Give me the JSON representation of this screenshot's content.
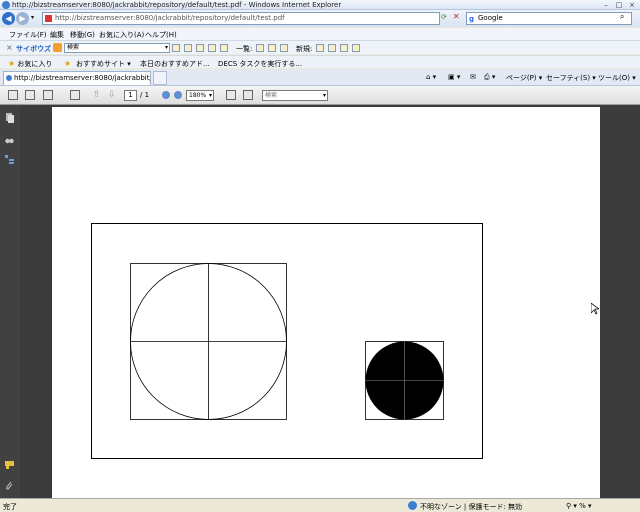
{
  "window": {
    "title": "http://bizstreamserver:8080/jackrabbit/repository/default/test.pdf - Windows Internet Explorer"
  },
  "address_bar": {
    "url": "http://bizstreamserver:8080/jackrabbit/repository/default/test.pdf",
    "search_value": "Google"
  },
  "menu": {
    "items": [
      "ファイル(F)",
      "編集",
      "移動(G)",
      "お気に入り(A)",
      "ヘルプ(H)"
    ]
  },
  "cyboz": {
    "logo": "サイボウズ",
    "search_value": "検索",
    "list_label": "一覧:",
    "new_label": "新規:"
  },
  "favorites": {
    "label": "お気に入り",
    "items": [
      "おすすめサイト ▾",
      "本日のおすすめアド...",
      "DECS タスクを実行する..."
    ]
  },
  "tabs": {
    "active_label": "http://bizstreamserver:8080/jackrabbit/rep...",
    "commands": [
      "ページ(P) ▾",
      "セーフティ(S) ▾",
      "ツール(O) ▾"
    ]
  },
  "pdf_toolbar": {
    "page_current": "1",
    "page_total": "/ 1",
    "zoom": "180%",
    "search_placeholder": "検索"
  },
  "status": {
    "left": "完了",
    "zone": "不明なゾーン | 保護モード: 無効",
    "zoom": "%"
  },
  "colors": {
    "accent": "#3c7fd1",
    "sidebar": "#414141",
    "doc_background": "#3b3b3b"
  }
}
